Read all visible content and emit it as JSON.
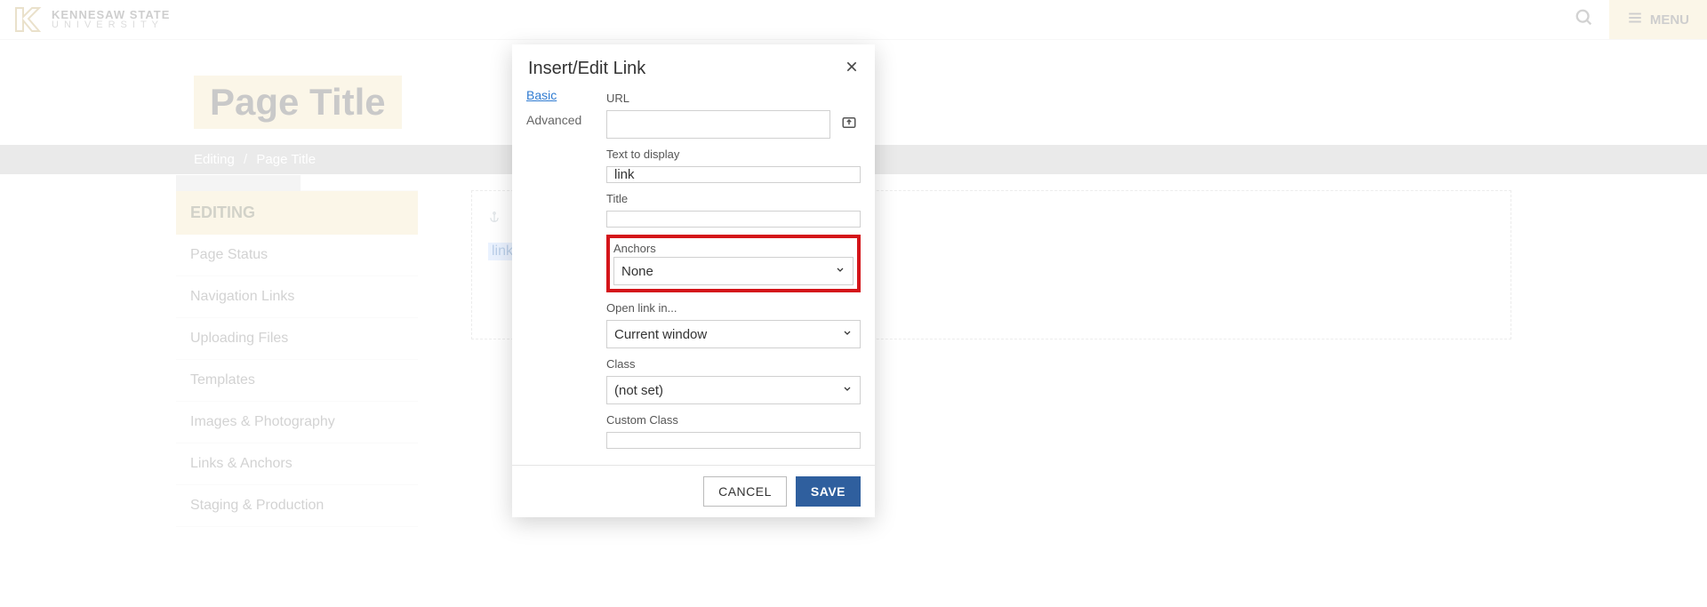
{
  "header": {
    "brand_line1": "KENNESAW STATE",
    "brand_line2": "UNIVERSITY",
    "menu_label": "MENU"
  },
  "page": {
    "title": "Page Title"
  },
  "breadcrumb": {
    "root": "Editing",
    "current": "Page Title"
  },
  "sidebar": {
    "heading": "EDITING",
    "items": [
      "Page Status",
      "Navigation Links",
      "Uploading Files",
      "Templates",
      "Images & Photography",
      "Links & Anchors",
      "Staging & Production"
    ]
  },
  "editor": {
    "selected_text": "link"
  },
  "modal": {
    "title": "Insert/Edit Link",
    "tabs": {
      "basic": "Basic",
      "advanced": "Advanced"
    },
    "labels": {
      "url": "URL",
      "text_to_display": "Text to display",
      "title": "Title",
      "anchors": "Anchors",
      "open_link_in": "Open link in...",
      "class": "Class",
      "custom_class": "Custom Class"
    },
    "values": {
      "url": "",
      "text_to_display": "link",
      "title": "",
      "anchors": "None",
      "open_link_in": "Current window",
      "class": "(not set)",
      "custom_class": ""
    },
    "buttons": {
      "cancel": "CANCEL",
      "save": "SAVE"
    }
  }
}
